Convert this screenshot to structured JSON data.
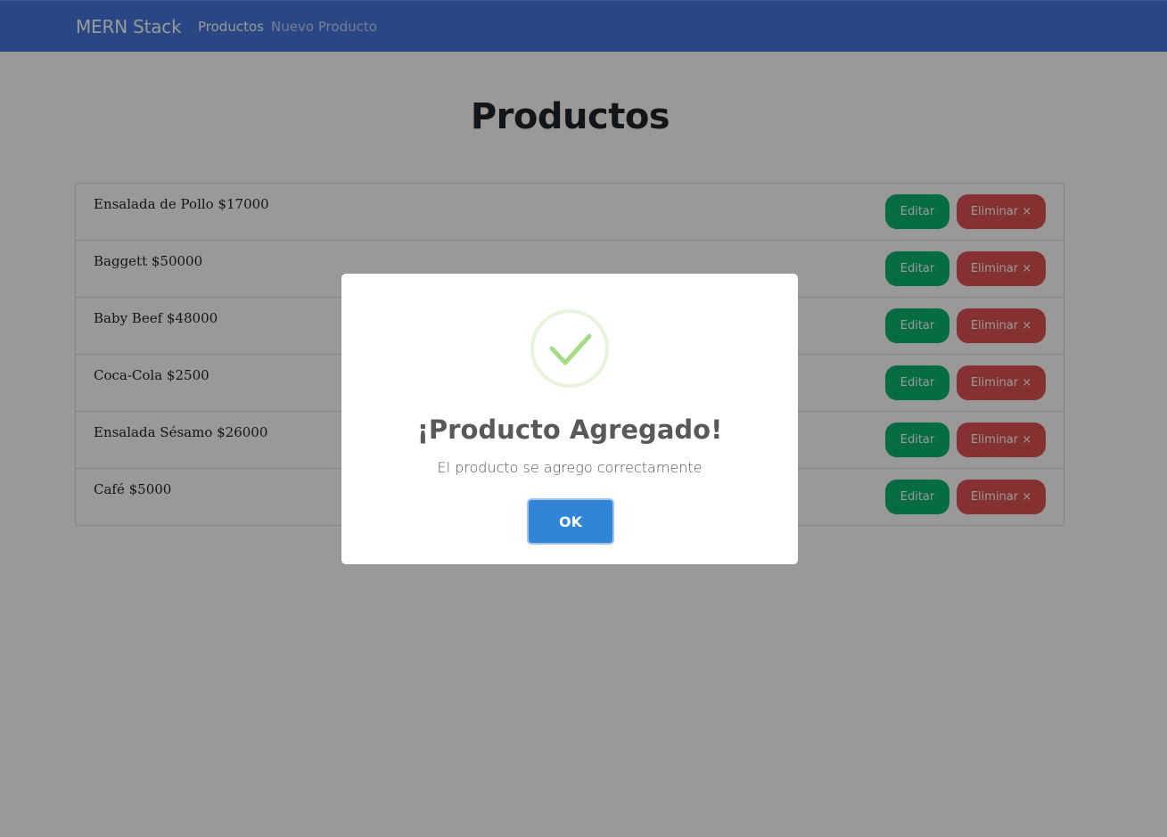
{
  "navbar": {
    "brand": "MERN Stack",
    "links": [
      {
        "label": "Productos",
        "active": true
      },
      {
        "label": "Nuevo Producto",
        "active": false
      }
    ]
  },
  "main": {
    "title": "Productos",
    "products": [
      {
        "text": "Ensalada de Pollo $17000",
        "edit_label": "Editar",
        "delete_label": "Eliminar ×"
      },
      {
        "text": "Baggett $50000",
        "edit_label": "Editar",
        "delete_label": "Eliminar ×"
      },
      {
        "text": "Baby Beef $48000",
        "edit_label": "Editar",
        "delete_label": "Eliminar ×"
      },
      {
        "text": "Coca-Cola $2500",
        "edit_label": "Editar",
        "delete_label": "Eliminar ×"
      },
      {
        "text": "Ensalada Sésamo $26000",
        "edit_label": "Editar",
        "delete_label": "Eliminar ×"
      },
      {
        "text": "Café $5000",
        "edit_label": "Editar",
        "delete_label": "Eliminar ×"
      }
    ]
  },
  "modal": {
    "icon": "success-check-icon",
    "title": "¡Producto Agregado!",
    "text": "El producto se agrego correctamente",
    "ok_label": "OK"
  },
  "colors": {
    "navbar": "#4477dd",
    "edit_button": "#0ab46e",
    "delete_button": "#e05252",
    "ok_button": "#3085d6",
    "check": "#a5dc86"
  }
}
